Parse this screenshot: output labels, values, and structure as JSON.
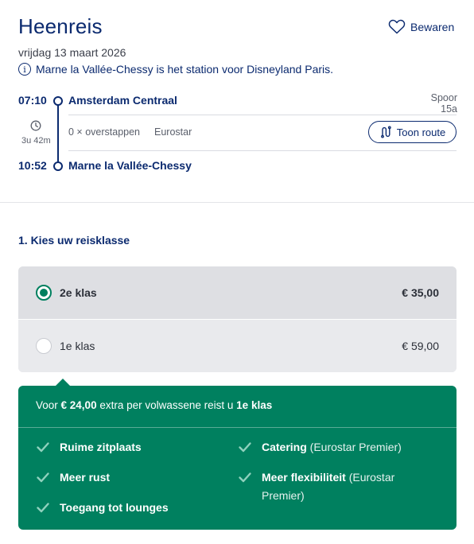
{
  "header": {
    "title": "Heenreis",
    "save_label": "Bewaren",
    "date": "vrijdag 13 maart 2026",
    "info": "Marne la Vallée-Chessy is het station voor Disneyland Paris."
  },
  "journey": {
    "departure_time": "07:10",
    "departure_station": "Amsterdam Centraal",
    "platform": "Spoor 15a",
    "duration": "3u 42m",
    "transfers": "0 × overstappen",
    "operator": "Eurostar",
    "route_button": "Toon route",
    "arrival_time": "10:52",
    "arrival_station": "Marne la Vallée-Chessy"
  },
  "class_section": {
    "title": "1. Kies uw reisklasse",
    "options": [
      {
        "label": "2e klas",
        "price": "€ 35,00",
        "selected": true
      },
      {
        "label": "1e klas",
        "price": "€ 59,00",
        "selected": false
      }
    ]
  },
  "promo": {
    "prefix": "Voor ",
    "amount": "€ 24,00",
    "middle": " extra per volwassene reist u ",
    "target": "1e klas",
    "features_left": [
      {
        "bold": "Ruime zitplaats",
        "extra": ""
      },
      {
        "bold": "Meer rust",
        "extra": ""
      },
      {
        "bold": "Toegang tot lounges",
        "extra": ""
      }
    ],
    "features_right": [
      {
        "bold": "Catering",
        "extra": " (Eurostar Premier)"
      },
      {
        "bold": "Meer flexibiliteit",
        "extra": " (Eurostar Premier)"
      }
    ]
  },
  "colors": {
    "navy": "#0b2a6f",
    "green": "#00805f",
    "panel_gray": "#e8e9ec"
  },
  "icons": [
    "heart-icon",
    "info-icon",
    "clock-icon",
    "route-icon",
    "check-icon"
  ]
}
